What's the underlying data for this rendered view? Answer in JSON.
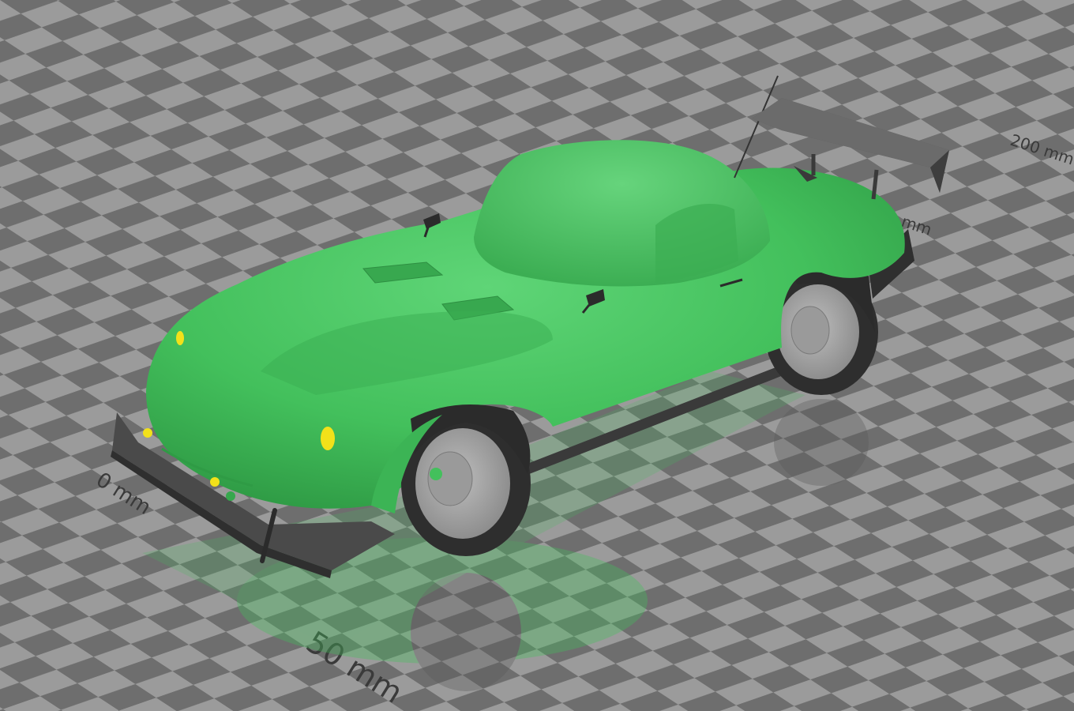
{
  "viewer": {
    "axis_labels": {
      "origin": "0 mm",
      "front_50": "50 mm",
      "side_200": "200 mm",
      "side_partial": "mm"
    }
  },
  "model": {
    "name": "",
    "body_color": "#43c05c",
    "body_shadow_color": "#36a84d",
    "light_color": "#f2e11a",
    "tire_color": "#2e2e2e",
    "wheel_color": "#a5a5a5",
    "trim_color": "#454545"
  },
  "floor": {
    "tile_light": "#9b9b9b",
    "tile_dark": "#6e6e6e"
  }
}
